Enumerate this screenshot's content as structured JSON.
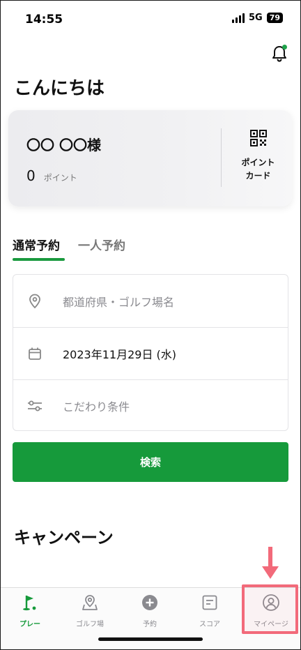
{
  "status_bar": {
    "time": "14:55",
    "network": "5G",
    "battery": "79"
  },
  "greeting": "こんにちは",
  "member_card": {
    "name": "〇〇 〇〇様",
    "points_value": "0",
    "points_unit": "ポイント",
    "point_card_label": "ポイント\nカード"
  },
  "tabs": [
    {
      "label": "通常予約",
      "active": true
    },
    {
      "label": "一人予約",
      "active": false
    }
  ],
  "search_form": {
    "location_placeholder": "都道府県・ゴルフ場名",
    "date_value": "2023年11月29日 (水)",
    "conditions_placeholder": "こだわり条件"
  },
  "search_button": "検索",
  "campaign_title": "キャンペーン",
  "bottom_nav": [
    {
      "label": "プレー",
      "icon": "golf-flag-icon",
      "active": true
    },
    {
      "label": "ゴルフ場",
      "icon": "map-pin-icon",
      "active": false
    },
    {
      "label": "予約",
      "icon": "plus-circle-icon",
      "active": false
    },
    {
      "label": "スコア",
      "icon": "score-card-icon",
      "active": false
    },
    {
      "label": "マイページ",
      "icon": "user-circle-icon",
      "active": false
    }
  ],
  "colors": {
    "accent": "#169a3b",
    "highlight": "#f26a7a",
    "notification_dot": "#1ea34a"
  }
}
